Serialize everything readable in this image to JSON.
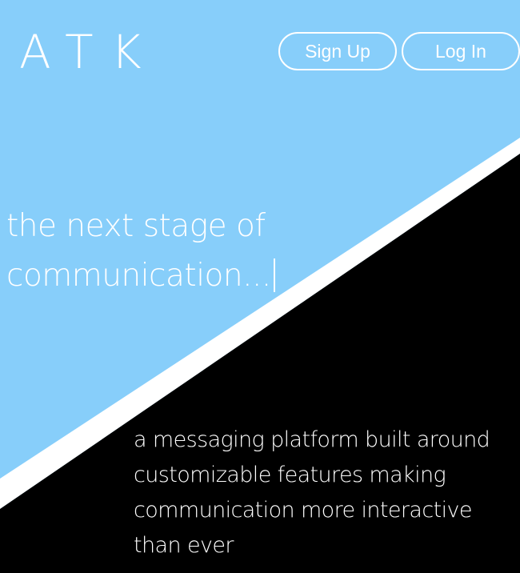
{
  "brand": {
    "logo_text": "ATK"
  },
  "nav": {
    "signup_label": "Sign Up",
    "login_label": "Log In"
  },
  "hero": {
    "tagline_line1": "the next stage of",
    "tagline_line2": "communication..."
  },
  "description": {
    "text": "a messaging platform built around customizable features making communication more interactive than ever"
  },
  "colors": {
    "sky_background": "#87cefa",
    "dark_panel": "#000000",
    "divider_stripe": "#ffffff",
    "text": "#ffffff"
  }
}
